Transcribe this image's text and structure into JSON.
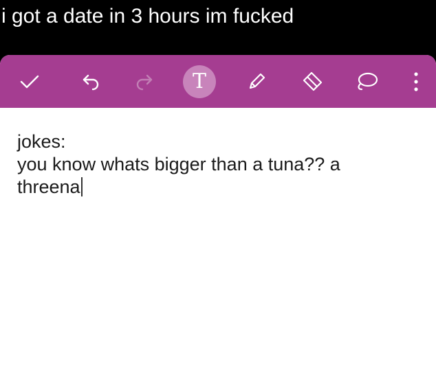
{
  "caption": {
    "text": "i got a date in 3 hours im fucked"
  },
  "toolbar": {
    "background_color": "#a53d91",
    "active_circle_color": "#c884bb",
    "buttons": [
      {
        "name": "checkmark-icon",
        "label": ""
      },
      {
        "name": "undo-icon",
        "label": ""
      },
      {
        "name": "redo-icon",
        "label": "",
        "disabled": true
      },
      {
        "name": "text-format-icon",
        "label": "T",
        "active": true
      },
      {
        "name": "pen-icon",
        "label": ""
      },
      {
        "name": "eraser-icon",
        "label": ""
      },
      {
        "name": "lasso-icon",
        "label": ""
      },
      {
        "name": "more-vertical-icon",
        "label": ""
      }
    ]
  },
  "note": {
    "lines": [
      "jokes:",
      "you know whats bigger than a tuna?? a",
      "threena"
    ],
    "text_color": "#1a1a1a"
  }
}
